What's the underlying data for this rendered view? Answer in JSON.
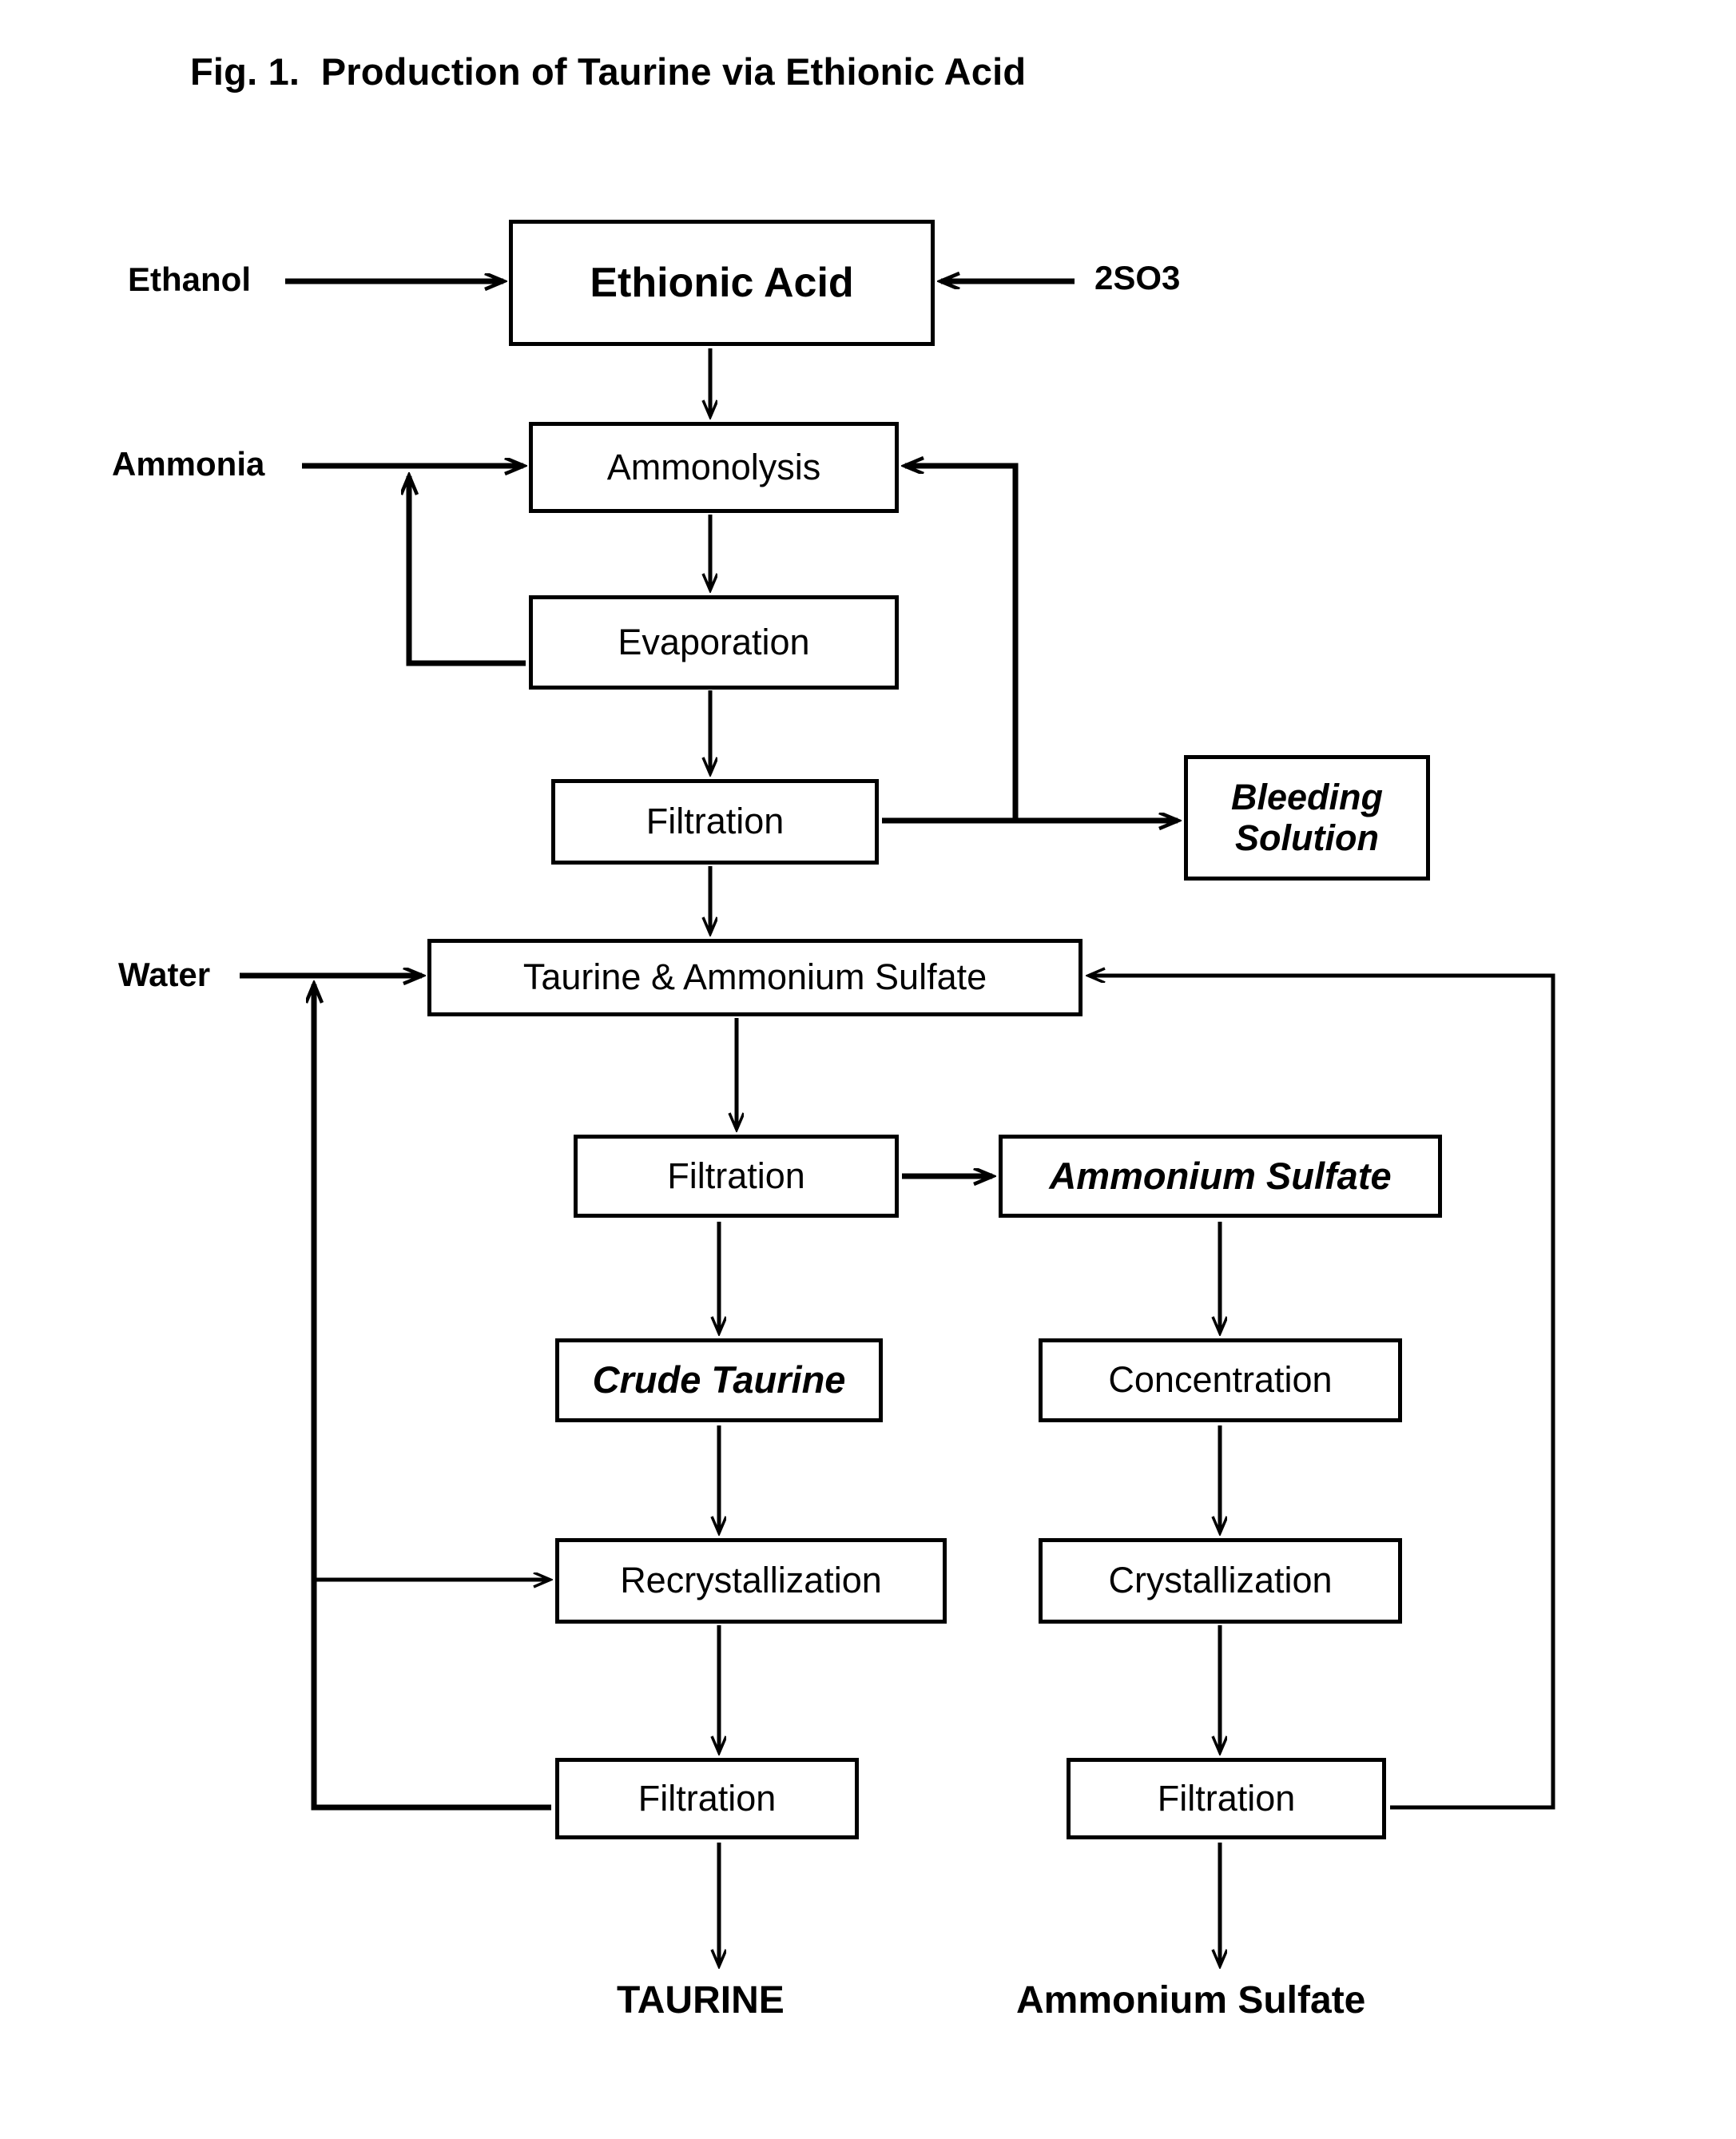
{
  "figure": {
    "title": "Fig. 1.  Production of Taurine via Ethionic Acid"
  },
  "inputs": {
    "ethanol": "Ethanol",
    "so3": "2SO3",
    "ammonia": "Ammonia",
    "water": "Water"
  },
  "outputs": {
    "taurine": "TAURINE",
    "ammonium_sulfate": "Ammonium Sulfate"
  },
  "nodes": [
    {
      "id": "ethionic_acid",
      "label": "Ethionic Acid",
      "emphasis": "bold"
    },
    {
      "id": "ammonolysis",
      "label": "Ammonolysis",
      "emphasis": "regular"
    },
    {
      "id": "evaporation",
      "label": "Evaporation",
      "emphasis": "regular"
    },
    {
      "id": "filtration_1",
      "label": "Filtration",
      "emphasis": "regular"
    },
    {
      "id": "bleeding",
      "label": "Bleeding\nSolution",
      "emphasis": "bold-italic"
    },
    {
      "id": "taurine_as",
      "label": "Taurine & Ammonium  Sulfate",
      "emphasis": "regular"
    },
    {
      "id": "filtration_2",
      "label": "Filtration",
      "emphasis": "regular"
    },
    {
      "id": "am_sulfate_box",
      "label": "Ammonium Sulfate",
      "emphasis": "bold-italic"
    },
    {
      "id": "crude_taurine",
      "label": "Crude Taurine",
      "emphasis": "bold-italic"
    },
    {
      "id": "concentration",
      "label": "Concentration",
      "emphasis": "regular"
    },
    {
      "id": "recrystallization",
      "label": "Recrystallization",
      "emphasis": "regular"
    },
    {
      "id": "crystallization",
      "label": "Crystallization",
      "emphasis": "regular"
    },
    {
      "id": "filtration_3",
      "label": "Filtration",
      "emphasis": "regular"
    },
    {
      "id": "filtration_4",
      "label": "Filtration",
      "emphasis": "regular"
    }
  ],
  "edges": [
    {
      "from": "Ethanol",
      "to": "ethionic_acid",
      "kind": "feed"
    },
    {
      "from": "2SO3",
      "to": "ethionic_acid",
      "kind": "feed"
    },
    {
      "from": "ethionic_acid",
      "to": "ammonolysis",
      "kind": "flow"
    },
    {
      "from": "Ammonia",
      "to": "ammonolysis",
      "kind": "feed"
    },
    {
      "from": "ammonolysis",
      "to": "evaporation",
      "kind": "flow"
    },
    {
      "from": "evaporation",
      "to": "ammonolysis",
      "kind": "recycle"
    },
    {
      "from": "evaporation",
      "to": "filtration_1",
      "kind": "flow"
    },
    {
      "from": "filtration_1",
      "to": "bleeding",
      "kind": "product"
    },
    {
      "from": "filtration_1",
      "to": "ammonolysis",
      "kind": "recycle"
    },
    {
      "from": "filtration_1",
      "to": "taurine_as",
      "kind": "flow"
    },
    {
      "from": "Water",
      "to": "taurine_as",
      "kind": "feed"
    },
    {
      "from": "taurine_as",
      "to": "filtration_2",
      "kind": "flow"
    },
    {
      "from": "filtration_2",
      "to": "am_sulfate_box",
      "kind": "flow"
    },
    {
      "from": "filtration_2",
      "to": "crude_taurine",
      "kind": "flow"
    },
    {
      "from": "am_sulfate_box",
      "to": "concentration",
      "kind": "flow"
    },
    {
      "from": "crude_taurine",
      "to": "recrystallization",
      "kind": "flow"
    },
    {
      "from": "concentration",
      "to": "crystallization",
      "kind": "flow"
    },
    {
      "from": "recrystallization",
      "to": "filtration_3",
      "kind": "flow"
    },
    {
      "from": "crystallization",
      "to": "filtration_4",
      "kind": "flow"
    },
    {
      "from": "filtration_3",
      "to": "TAURINE",
      "kind": "product"
    },
    {
      "from": "filtration_4",
      "to": "Ammonium Sulfate",
      "kind": "product"
    },
    {
      "from": "filtration_3",
      "to": "recrystallization",
      "kind": "recycle"
    },
    {
      "from": "filtration_3",
      "to": "taurine_as",
      "kind": "recycle"
    },
    {
      "from": "filtration_4",
      "to": "taurine_as",
      "kind": "recycle"
    }
  ],
  "colors": {
    "ink": "#000000",
    "paper": "#ffffff"
  }
}
